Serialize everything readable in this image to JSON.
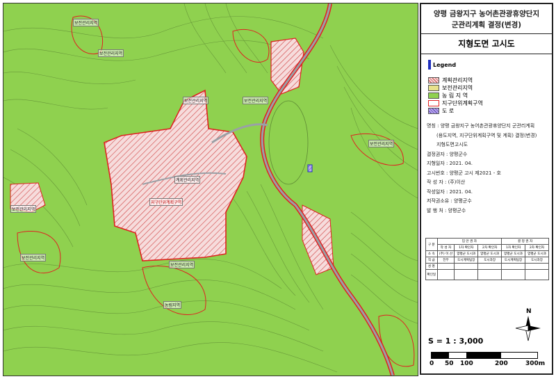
{
  "title": {
    "line1": "양평 금왕지구 농어촌관광휴양단지",
    "line2": "군관리계획 결정(변경)"
  },
  "subtitle": "지형도면 고시도",
  "legend": {
    "heading": "Legend",
    "items": [
      {
        "label": "계획관리지역",
        "color": "#f3c9c9",
        "icon": "hatch-red"
      },
      {
        "label": "보전관리지역",
        "color": "#e8e28c",
        "icon": "swatch-yellow"
      },
      {
        "label": "농 림 지 역",
        "color": "#8fd14f",
        "icon": "swatch-green"
      },
      {
        "label": "지구단위계획구역",
        "color": "#ffffff",
        "icon": "outline-red"
      },
      {
        "label": "도 로",
        "color": "#b9a9ee",
        "icon": "hatch-purple"
      }
    ]
  },
  "info": {
    "name": "명칭 : 양평 금왕지구 농어촌관광휴양단지 군관리계획",
    "name2": "(용도지역, 지구단위계획구역 및 계획) 결정(변경)",
    "name3": "지형도면고시도",
    "decision": "결정권자 : 양평군수",
    "date": "지형일자 : 2021. 04.",
    "notice": "고시번호 : 양평군 고시 제2021 -     호",
    "author": "작 성 자 : (주)이산",
    "made": "작성일자 : 2021. 04.",
    "owner": "저작권소유 : 양평군수",
    "issuer": "발 행 처 : 양평군수"
  },
  "approval_table": {
    "header_left": "입 안 권 자",
    "header_right": "결 정 권 자",
    "rows": [
      [
        "구 분",
        "",
        "",
        "",
        "",
        ""
      ],
      [
        "",
        "작 성 자",
        "1차 확인자",
        "2차 확인자",
        "1차 확인자",
        "2차 확인자"
      ],
      [
        "소 속",
        "(주) 이 산",
        "양평군 도시과",
        "양평군 도시과",
        "양평군 도시과",
        "양평군 도시과"
      ],
      [
        "직 급",
        "전무",
        "도시계획팀장",
        "도시과장",
        "도시계획팀장",
        "도시과장"
      ],
      [
        "성 명",
        "",
        "",
        "",
        "",
        ""
      ],
      [
        "확인일",
        "",
        "",
        "",
        "",
        ""
      ]
    ]
  },
  "scale": {
    "label": "S = 1 : 3,000",
    "ticks": [
      "0",
      "50",
      "100",
      "200",
      "300m"
    ]
  },
  "north_label": "N",
  "map": {
    "labels": [
      {
        "text": "보전관리지역"
      },
      {
        "text": "보전관리지역"
      },
      {
        "text": "보전관리지역"
      },
      {
        "text": "보전관리지역"
      },
      {
        "text": "보전관리지역"
      },
      {
        "text": "보전관리지역"
      },
      {
        "text": "보전관리지역"
      },
      {
        "text": "계획관리지역"
      },
      {
        "text": "지구단위계획구역"
      },
      {
        "text": "보전관리지역"
      },
      {
        "text": "농림지역"
      }
    ],
    "colors": {
      "farmland": "#8fd14f",
      "plan_area": "#f3c9c9",
      "contour": "#6a8f3a",
      "boundary": "#e02020",
      "road": "#9aa0a6"
    }
  }
}
